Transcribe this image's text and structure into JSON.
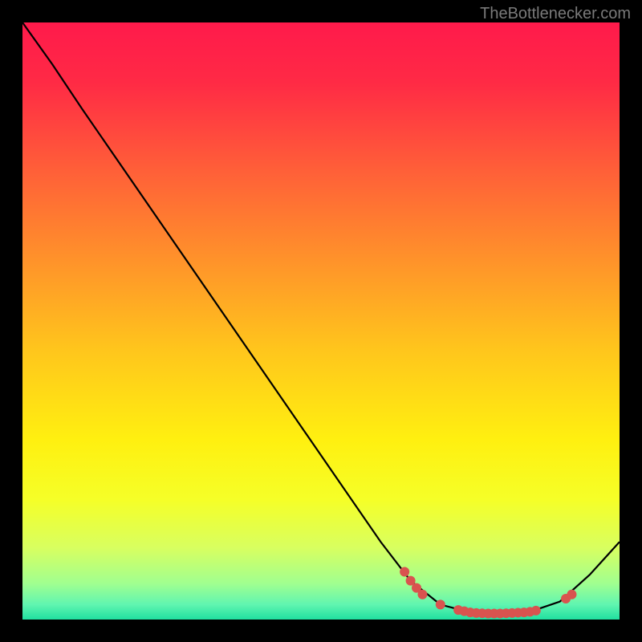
{
  "watermark": "TheBottlenecker.com",
  "chart_data": {
    "type": "line",
    "title": "",
    "xlabel": "",
    "ylabel": "",
    "xlim": [
      0,
      100
    ],
    "ylim": [
      0,
      100
    ],
    "background": {
      "type": "vertical_gradient",
      "stops": [
        {
          "offset": 0.0,
          "color": "#ff1a4b"
        },
        {
          "offset": 0.1,
          "color": "#ff2a45"
        },
        {
          "offset": 0.25,
          "color": "#ff6038"
        },
        {
          "offset": 0.4,
          "color": "#ff932a"
        },
        {
          "offset": 0.55,
          "color": "#ffc61c"
        },
        {
          "offset": 0.7,
          "color": "#fff010"
        },
        {
          "offset": 0.8,
          "color": "#f5ff28"
        },
        {
          "offset": 0.88,
          "color": "#d8ff60"
        },
        {
          "offset": 0.94,
          "color": "#a0ff90"
        },
        {
          "offset": 0.975,
          "color": "#60f5b0"
        },
        {
          "offset": 1.0,
          "color": "#20e0a0"
        }
      ]
    },
    "series": [
      {
        "name": "curve",
        "type": "line",
        "color": "#000000",
        "points": [
          {
            "x": 0,
            "y": 100
          },
          {
            "x": 5,
            "y": 93
          },
          {
            "x": 10,
            "y": 85.5
          },
          {
            "x": 20,
            "y": 71
          },
          {
            "x": 30,
            "y": 56.5
          },
          {
            "x": 40,
            "y": 42
          },
          {
            "x": 50,
            "y": 27.5
          },
          {
            "x": 60,
            "y": 13
          },
          {
            "x": 65,
            "y": 6.5
          },
          {
            "x": 70,
            "y": 2.5
          },
          {
            "x": 75,
            "y": 1.2
          },
          {
            "x": 80,
            "y": 1.0
          },
          {
            "x": 85,
            "y": 1.3
          },
          {
            "x": 90,
            "y": 3.0
          },
          {
            "x": 95,
            "y": 7.5
          },
          {
            "x": 100,
            "y": 13
          }
        ]
      },
      {
        "name": "markers",
        "type": "scatter",
        "color": "#d9534f",
        "points": [
          {
            "x": 64,
            "y": 8.0
          },
          {
            "x": 65,
            "y": 6.5
          },
          {
            "x": 66,
            "y": 5.3
          },
          {
            "x": 67,
            "y": 4.2
          },
          {
            "x": 70,
            "y": 2.5
          },
          {
            "x": 73,
            "y": 1.6
          },
          {
            "x": 74,
            "y": 1.4
          },
          {
            "x": 75,
            "y": 1.2
          },
          {
            "x": 76,
            "y": 1.1
          },
          {
            "x": 77,
            "y": 1.05
          },
          {
            "x": 78,
            "y": 1.0
          },
          {
            "x": 79,
            "y": 1.0
          },
          {
            "x": 80,
            "y": 1.0
          },
          {
            "x": 81,
            "y": 1.05
          },
          {
            "x": 82,
            "y": 1.1
          },
          {
            "x": 83,
            "y": 1.15
          },
          {
            "x": 84,
            "y": 1.2
          },
          {
            "x": 85,
            "y": 1.3
          },
          {
            "x": 86,
            "y": 1.5
          },
          {
            "x": 91,
            "y": 3.5
          },
          {
            "x": 92,
            "y": 4.2
          }
        ]
      }
    ]
  }
}
